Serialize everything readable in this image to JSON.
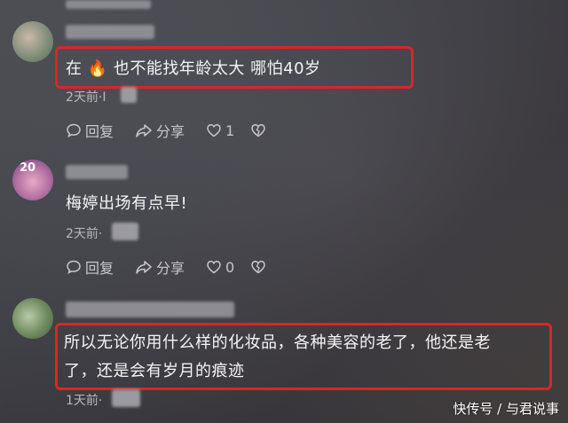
{
  "comments": [
    {
      "text_pre": "在",
      "text_post": "也不能找年龄太大 哪怕40岁",
      "emoji": "🔥",
      "time": "2天前·I",
      "reply": "回复",
      "share": "分享",
      "likes": "1"
    },
    {
      "text": "梅婷出场有点早!",
      "time": "2天前·",
      "reply": "回复",
      "share": "分享",
      "likes": "0",
      "avatar_text": "20"
    },
    {
      "text_line1": "所以无论你用什么样的化妆品，各种美容的老了，他还是老",
      "text_line2": "了，还是会有岁月的痕迹",
      "time": "1天前·"
    }
  ],
  "watermark": "快传号 / 与君说事",
  "colors": {
    "highlight": "#d8262a"
  },
  "icons": [
    "reply-icon",
    "share-icon",
    "heart-icon",
    "dislike-heart-icon",
    "fire-emoji"
  ]
}
